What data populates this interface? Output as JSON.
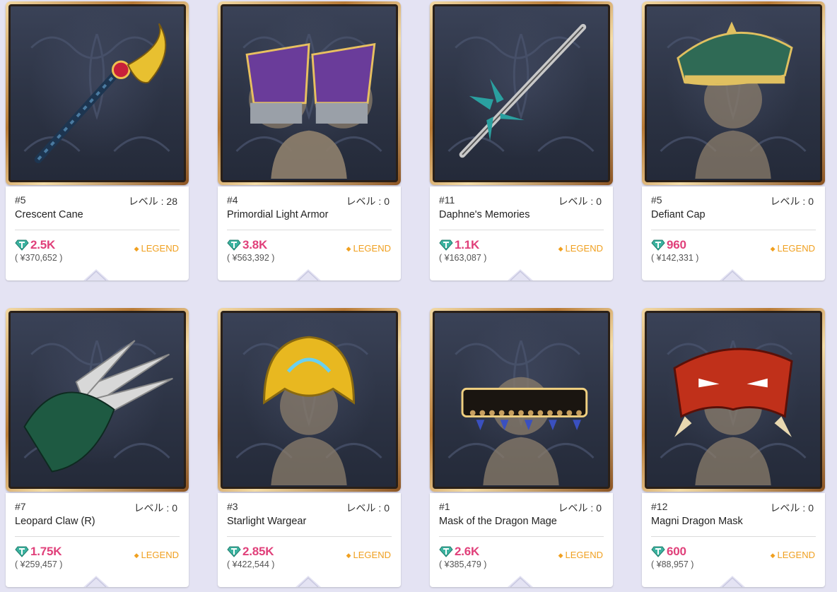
{
  "items": [
    {
      "rank": "#5",
      "level": "レベル : 28",
      "name": "Crescent Cane",
      "price": "2.5K",
      "yen": "( ¥370,652 )",
      "rarity": "LEGEND",
      "art": "crescent-cane-icon"
    },
    {
      "rank": "#4",
      "level": "レベル : 0",
      "name": "Primordial Light Armor",
      "price": "3.8K",
      "yen": "( ¥563,392 )",
      "rarity": "LEGEND",
      "art": "armor-icon"
    },
    {
      "rank": "#11",
      "level": "レベル : 0",
      "name": "Daphne's Memories",
      "price": "1.1K",
      "yen": "( ¥163,087 )",
      "rarity": "LEGEND",
      "art": "sword-icon"
    },
    {
      "rank": "#5",
      "level": "レベル : 0",
      "name": "Defiant Cap",
      "price": "960",
      "yen": "( ¥142,331 )",
      "rarity": "LEGEND",
      "art": "cap-icon"
    },
    {
      "rank": "#7",
      "level": "レベル : 0",
      "name": "Leopard Claw (R)",
      "price": "1.75K",
      "yen": "( ¥259,457 )",
      "rarity": "LEGEND",
      "art": "claw-icon"
    },
    {
      "rank": "#3",
      "level": "レベル : 0",
      "name": "Starlight Wargear",
      "price": "2.85K",
      "yen": "( ¥422,544 )",
      "rarity": "LEGEND",
      "art": "crown-icon"
    },
    {
      "rank": "#1",
      "level": "レベル : 0",
      "name": "Mask of the Dragon Mage",
      "price": "2.6K",
      "yen": "( ¥385,479 )",
      "rarity": "LEGEND",
      "art": "choker-icon"
    },
    {
      "rank": "#12",
      "level": "レベル : 0",
      "name": "Magni Dragon Mask",
      "price": "600",
      "yen": "( ¥88,957 )",
      "rarity": "LEGEND",
      "art": "dragon-mask-icon"
    }
  ],
  "colors": {
    "price": "#e0407a",
    "legend": "#f0a020",
    "gem": "#3bb3a0",
    "frame_gold": "#c08a45"
  }
}
